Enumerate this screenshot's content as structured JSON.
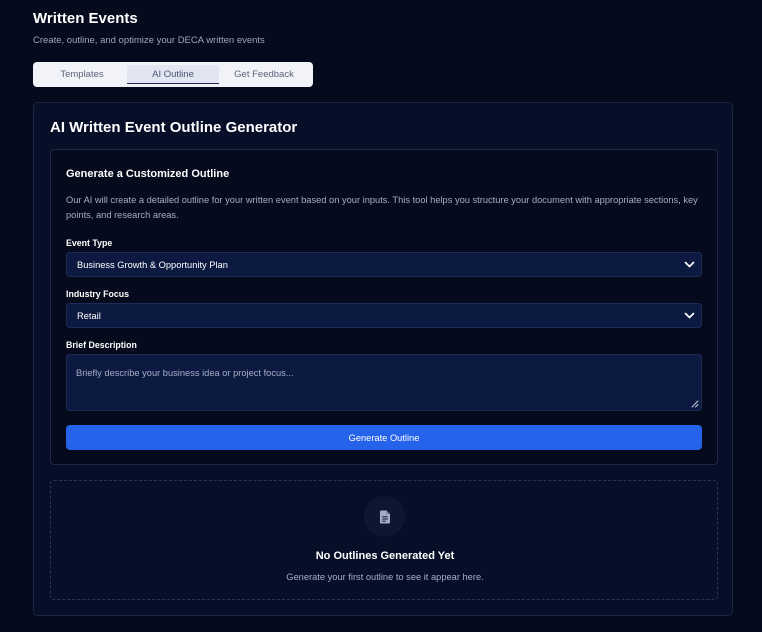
{
  "header": {
    "title": "Written Events",
    "subtitle": "Create, outline, and optimize your DECA written events"
  },
  "tabs": [
    {
      "label": "Templates",
      "active": false
    },
    {
      "label": "AI Outline",
      "active": true
    },
    {
      "label": "Get Feedback",
      "active": false
    }
  ],
  "main": {
    "title": "AI Written Event Outline Generator"
  },
  "form": {
    "title": "Generate a Customized Outline",
    "description": "Our AI will create a detailed outline for your written event based on your inputs. This tool helps you structure your document with appropriate sections, key points, and research areas.",
    "event_type": {
      "label": "Event Type",
      "value": "Business Growth & Opportunity Plan"
    },
    "industry": {
      "label": "Industry Focus",
      "value": "Retail"
    },
    "description_field": {
      "label": "Brief Description",
      "placeholder": "Briefly describe your business idea or project focus..."
    },
    "button_label": "Generate Outline"
  },
  "empty_state": {
    "icon": "document-icon",
    "title": "No Outlines Generated Yet",
    "text": "Generate your first outline to see it appear here."
  },
  "colors": {
    "background": "#050b1c",
    "card": "#070f28",
    "input": "#0c1a42",
    "accent": "#2563eb",
    "muted_text": "#a3aec6"
  }
}
